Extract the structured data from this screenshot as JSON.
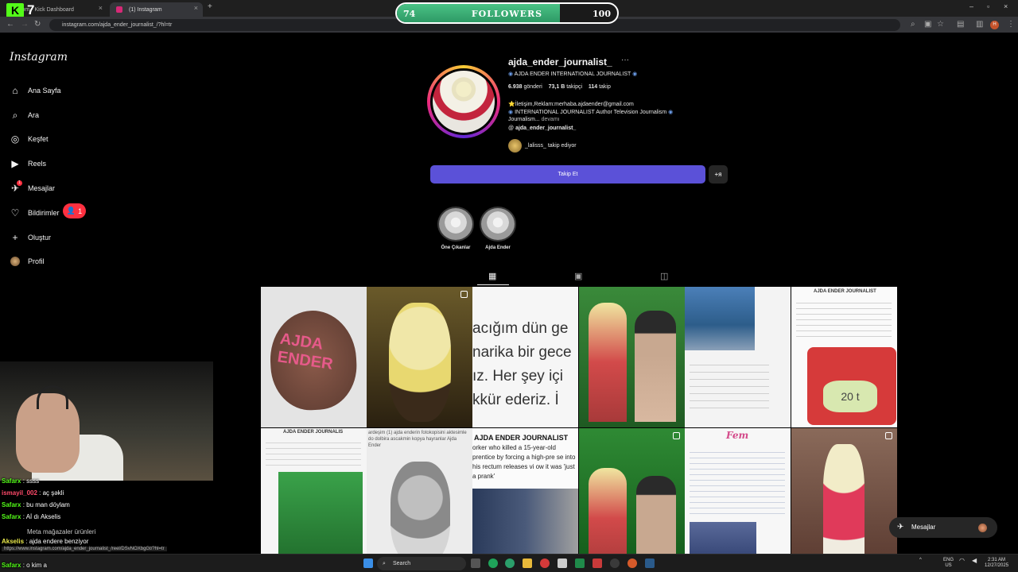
{
  "browser": {
    "tabs": [
      {
        "title": "com - Kick Dashboard",
        "active": false
      },
      {
        "title": "(1) Instagram",
        "active": true
      }
    ],
    "new_tab": "+",
    "url": "instagram.com/ajda_ender_journalist_/?hl=tr",
    "status_url": "https://www.instagram.com/ajda_ender_journalist_/reel/DSvNOXbgGt/?hl=tr"
  },
  "followers_goal": {
    "label": "FOLLOWERS",
    "current": "74",
    "goal": "100",
    "progress": 0.74
  },
  "sidebar": {
    "logo": "Instagram",
    "items": [
      {
        "label": "Ana Sayfa",
        "icon": "home-icon"
      },
      {
        "label": "Ara",
        "icon": "search-icon"
      },
      {
        "label": "Keşfet",
        "icon": "compass-icon"
      },
      {
        "label": "Reels",
        "icon": "reels-icon"
      },
      {
        "label": "Mesajlar",
        "icon": "messenger-icon"
      },
      {
        "label": "Bildirimler",
        "icon": "heart-icon"
      },
      {
        "label": "Oluştur",
        "icon": "plus-icon"
      },
      {
        "label": "Profil",
        "icon": "avatar"
      }
    ],
    "notifications_badge": "1",
    "messages_badge": "1"
  },
  "profile": {
    "username": "ajda_ender_journalist_",
    "more": "···",
    "category_line": "AJDA ENDER INTERNATIONAL JOURNALIST",
    "stats": {
      "posts": "6.938",
      "posts_label": "gönderi",
      "followers": "73,1 B",
      "followers_label": "takipçi",
      "following": "114",
      "following_label": "takip"
    },
    "bio_line1": "⭐İletişim,Reklam:merhaba.ajdaender@gmail.com",
    "bio_line2": "INTERNATIONAL JOURNALIST Author Television Journalism",
    "bio_line3": "Journalism...",
    "bio_more": "devamı",
    "threads_handle": "ajda_ender_journalist_",
    "followed_by_user": "_lalisss_",
    "followed_by_suffix": "takip ediyor",
    "follow_button": "Takip Et",
    "suggest_button": "+ᴙ"
  },
  "highlights": [
    {
      "label": "Öne Çıkanlar"
    },
    {
      "label": "Ajda Ender"
    }
  ],
  "profile_tabs": [
    "grid-icon",
    "reels-tab-icon",
    "tagged-icon"
  ],
  "posts": {
    "p1_text": "AJDA ENDER",
    "p3_text": "acığım dün ge narika bir gece ız. Her şey içi kkür ederiz. İ",
    "p6_title": "AJDA ENDER JOURNALIST",
    "p6_badge": "20 t",
    "p7_title": "AJDA ENDER JOURNALIS",
    "p8_caption": "ardeşim (1) ajda enderin fotokopisini aktesimle do dolbira ascakmin kopya hayranlar Ajda Ender",
    "p9_title": "AJDA ENDER JOURNALIST",
    "p9_text": "orker who killed a 15-year-old prentice by forcing a high-pre se into his rectum releases vi ow it was 'just a prank'",
    "p11_logo": "Fem"
  },
  "chat": [
    {
      "user": "Safarx",
      "msg": "ssss"
    },
    {
      "user": "ismayil_002",
      "msg": "aç şəkli"
    },
    {
      "user": "Safarx",
      "msg": "bu man döylam"
    },
    {
      "user": "Safarx",
      "msg": "Aİ dı Akselis"
    },
    {
      "user": "",
      "msg": "Meta mağazaler ürünleri"
    },
    {
      "user": "Akselis",
      "msg": "ajda endere benziyor"
    },
    {
      "user": "Safarx",
      "msg": "o kim a"
    }
  ],
  "messages_pill": "Mesajlar",
  "taskbar": {
    "search": "Search",
    "lang": "ENG",
    "region": "US",
    "time": "2:31 AM",
    "date": "12/27/2025"
  }
}
